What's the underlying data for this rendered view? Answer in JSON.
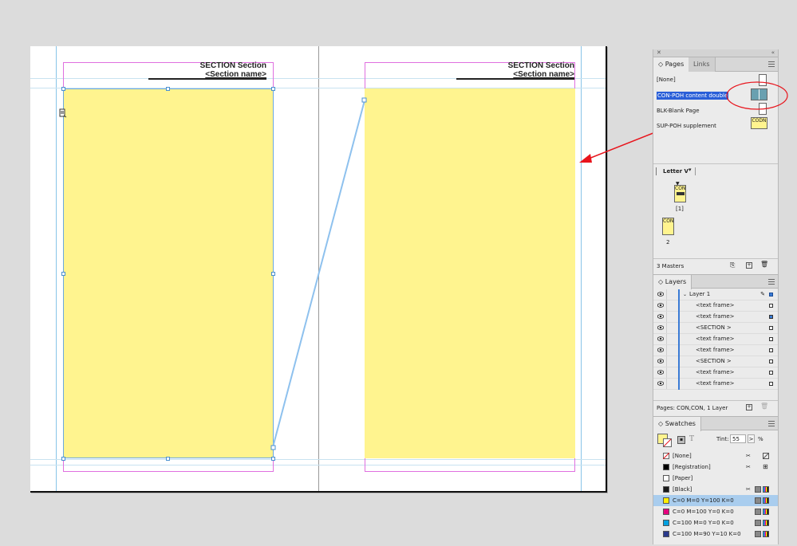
{
  "document": {
    "left_page": {
      "header_line1": "SECTION Section",
      "header_line2": "<Section name>"
    },
    "right_page": {
      "header_line1": "SECTION Section",
      "header_line2": "<Section name>"
    }
  },
  "panel": {
    "pages_tab": "Pages",
    "links_tab": "Links",
    "masters": [
      {
        "label": "[None]"
      },
      {
        "label": "CON-POH content double",
        "selected": true
      },
      {
        "label": "BLK-Blank Page"
      },
      {
        "label": "SUP-POH supplement",
        "thumb_text": "CODN"
      }
    ],
    "page_size_label": "Letter V",
    "pages": [
      {
        "thumb_text": "CON",
        "number": "[1]"
      },
      {
        "thumb_text": "CON",
        "number": "2"
      }
    ],
    "pages_footer": "3 Masters",
    "layers_tab": "Layers",
    "layers": [
      {
        "name": "Layer 1"
      },
      {
        "name": "<text frame>"
      },
      {
        "name": "<text frame>"
      },
      {
        "name": "<SECTION >"
      },
      {
        "name": "<text frame>"
      },
      {
        "name": "<text frame>"
      },
      {
        "name": "<SECTION >"
      },
      {
        "name": "<text frame>"
      },
      {
        "name": "<text frame>"
      }
    ],
    "layers_footer": "Pages: CON,CON, 1 Layer",
    "swatches_tab": "Swatches",
    "tint_label": "Tint:",
    "tint_value": "55",
    "tint_unit": "%",
    "swatches": [
      {
        "name": "[None]",
        "color": "none"
      },
      {
        "name": "[Registration]",
        "color": "#000000"
      },
      {
        "name": "[Paper]",
        "color": "#ffffff"
      },
      {
        "name": "[Black]",
        "color": "#1a1a1a"
      },
      {
        "name": "C=0 M=0 Y=100 K=0",
        "color": "#ffee00",
        "selected": true
      },
      {
        "name": "C=0 M=100 Y=0 K=0",
        "color": "#e6007e"
      },
      {
        "name": "C=100 M=0 Y=0 K=0",
        "color": "#00a0e0"
      },
      {
        "name": "C=100 M=90 Y=10 K=0",
        "color": "#2a3a8c"
      }
    ]
  },
  "colors": {
    "frame_fill": "#fff48f",
    "margin_guide": "#e070e0",
    "column_guide": "#88c4e8",
    "selection": "#6aa8e0",
    "annotation_red": "#e8141c",
    "highlight_blue": "#2a5fd8"
  }
}
